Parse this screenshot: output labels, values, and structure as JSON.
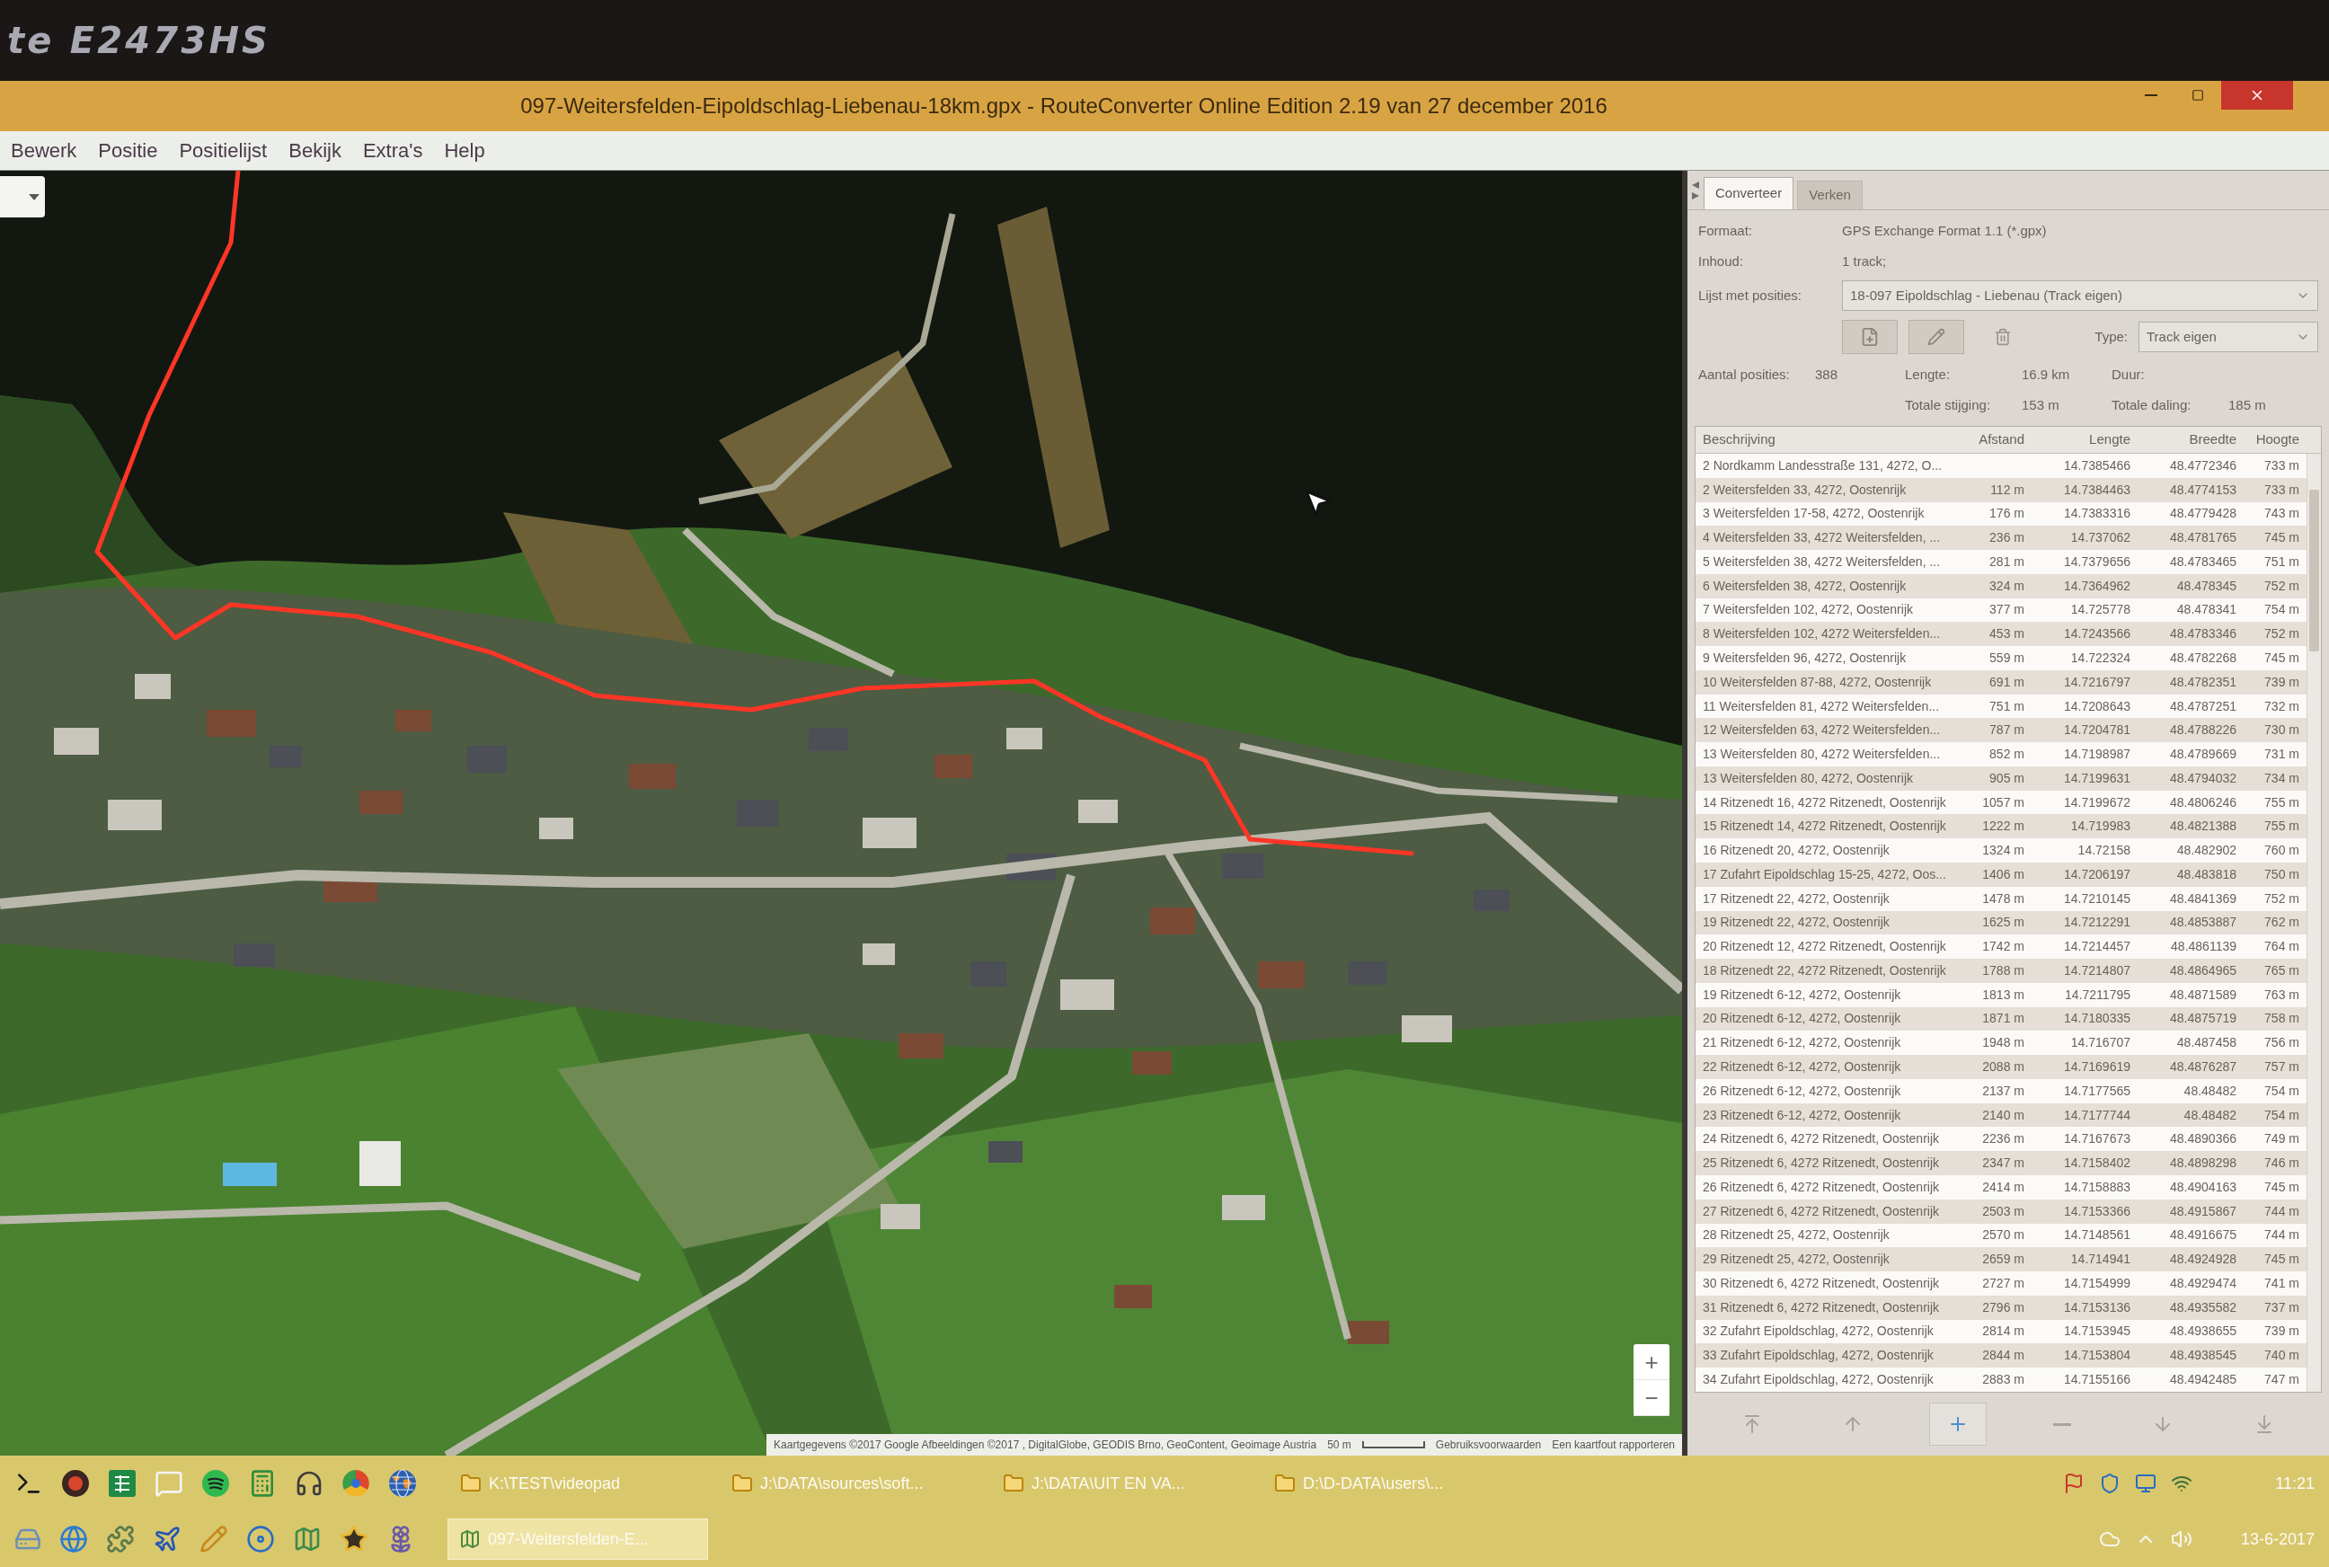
{
  "monitor": {
    "model_label": "te E2473HS"
  },
  "window": {
    "title": "097-Weitersfelden-Eipoldschlag-Liebenau-18km.gpx - RouteConverter Online Edition 2.19 van 27 december 2016"
  },
  "menu": [
    "Bewerk",
    "Positie",
    "Positielijst",
    "Bekijk",
    "Extra's",
    "Help"
  ],
  "map": {
    "zoom_buttons": [
      "+",
      "−"
    ],
    "attribution": "Kaartgegevens ©2017 Google Afbeeldingen ©2017 , DigitalGlobe, GEODIS Brno, GeoContent, Geoimage Austria",
    "scale": "50 m",
    "links": [
      "Gebruiksvoorwaarden",
      "Een kaartfout rapporteren"
    ]
  },
  "panel": {
    "tabs": [
      {
        "label": "Converteer",
        "selected": true
      },
      {
        "label": "Verken",
        "selected": false
      }
    ],
    "info": [
      {
        "label": "Formaat:",
        "value": "GPS Exchange Format 1.1 (*.gpx)"
      },
      {
        "label": "Inhoud:",
        "value": "1 track;"
      }
    ],
    "position_list": {
      "label": "Lijst met posities:",
      "value": "18-097 Eipoldschlag - Liebenau (Track eigen)"
    },
    "type": {
      "label": "Type:",
      "value": "Track eigen"
    },
    "stats": [
      [
        {
          "label": "Aantal posities:",
          "value": "388"
        },
        {
          "label": "Lengte:",
          "value": "16.9 km"
        },
        {
          "label": "Duur:"
        }
      ],
      [
        {
          "label": "Totale stijging:",
          "value": "153 m"
        },
        {
          "label": "Totale daling:",
          "value": "185 m"
        }
      ]
    ],
    "table": {
      "columns": [
        "Beschrijving",
        "Afstand",
        "Lengte",
        "Breedte",
        "Hoogte"
      ],
      "rows": [
        {
          "description": "2 Nordkamm Landesstraße 131, 4272, O...",
          "longitude": "14.7385466",
          "latitude": "48.4772346",
          "elevation": "733 m"
        },
        {
          "description": "2 Weitersfelden 33, 4272, Oostenrijk",
          "distance": "112 m",
          "longitude": "14.7384463",
          "latitude": "48.4774153",
          "elevation": "733 m"
        },
        {
          "description": "3 Weitersfelden 17-58, 4272, Oostenrijk",
          "distance": "176 m",
          "longitude": "14.7383316",
          "latitude": "48.4779428",
          "elevation": "743 m"
        },
        {
          "description": "4 Weitersfelden 33, 4272 Weitersfelden, ...",
          "distance": "236 m",
          "longitude": "14.737062",
          "latitude": "48.4781765",
          "elevation": "745 m"
        },
        {
          "description": "5 Weitersfelden 38, 4272 Weitersfelden, ...",
          "distance": "281 m",
          "longitude": "14.7379656",
          "latitude": "48.4783465",
          "elevation": "751 m"
        },
        {
          "description": "6 Weitersfelden 38, 4272, Oostenrijk",
          "distance": "324 m",
          "longitude": "14.7364962",
          "latitude": "48.478345",
          "elevation": "752 m"
        },
        {
          "description": "7 Weitersfelden 102, 4272, Oostenrijk",
          "distance": "377 m",
          "longitude": "14.725778",
          "latitude": "48.478341",
          "elevation": "754 m"
        },
        {
          "description": "8 Weitersfelden 102, 4272 Weitersfelden...",
          "distance": "453 m",
          "longitude": "14.7243566",
          "latitude": "48.4783346",
          "elevation": "752 m"
        },
        {
          "description": "9 Weitersfelden 96, 4272, Oostenrijk",
          "distance": "559 m",
          "longitude": "14.722324",
          "latitude": "48.4782268",
          "elevation": "745 m"
        },
        {
          "description": "10 Weitersfelden 87-88, 4272, Oostenrijk",
          "distance": "691 m",
          "longitude": "14.7216797",
          "latitude": "48.4782351",
          "elevation": "739 m"
        },
        {
          "description": "11 Weitersfelden 81, 4272 Weitersfelden...",
          "distance": "751 m",
          "longitude": "14.7208643",
          "latitude": "48.4787251",
          "elevation": "732 m"
        },
        {
          "description": "12 Weitersfelden 63, 4272 Weitersfelden...",
          "distance": "787 m",
          "longitude": "14.7204781",
          "latitude": "48.4788226",
          "elevation": "730 m"
        },
        {
          "description": "13 Weitersfelden 80, 4272 Weitersfelden...",
          "distance": "852 m",
          "longitude": "14.7198987",
          "latitude": "48.4789669",
          "elevation": "731 m"
        },
        {
          "description": "13 Weitersfelden 80, 4272, Oostenrijk",
          "distance": "905 m",
          "longitude": "14.7199631",
          "latitude": "48.4794032",
          "elevation": "734 m"
        },
        {
          "description": "14 Ritzenedt 16, 4272 Ritzenedt, Oostenrijk",
          "distance": "1057 m",
          "longitude": "14.7199672",
          "latitude": "48.4806246",
          "elevation": "755 m"
        },
        {
          "description": "15 Ritzenedt 14, 4272 Ritzenedt, Oostenrijk",
          "distance": "1222 m",
          "longitude": "14.719983",
          "latitude": "48.4821388",
          "elevation": "755 m"
        },
        {
          "description": "16 Ritzenedt 20, 4272, Oostenrijk",
          "distance": "1324 m",
          "longitude": "14.72158",
          "latitude": "48.482902",
          "elevation": "760 m"
        },
        {
          "description": "17 Zufahrt Eipoldschlag 15-25, 4272, Oos...",
          "distance": "1406 m",
          "longitude": "14.7206197",
          "latitude": "48.483818",
          "elevation": "750 m"
        },
        {
          "description": "17 Ritzenedt 22, 4272, Oostenrijk",
          "distance": "1478 m",
          "longitude": "14.7210145",
          "latitude": "48.4841369",
          "elevation": "752 m"
        },
        {
          "description": "19 Ritzenedt 22, 4272, Oostenrijk",
          "distance": "1625 m",
          "longitude": "14.7212291",
          "latitude": "48.4853887",
          "elevation": "762 m"
        },
        {
          "description": "20 Ritzenedt 12, 4272 Ritzenedt, Oostenrijk",
          "distance": "1742 m",
          "longitude": "14.7214457",
          "latitude": "48.4861139",
          "elevation": "764 m"
        },
        {
          "description": "18 Ritzenedt 22, 4272 Ritzenedt, Oostenrijk",
          "distance": "1788 m",
          "longitude": "14.7214807",
          "latitude": "48.4864965",
          "elevation": "765 m"
        },
        {
          "description": "19 Ritzenedt 6-12, 4272, Oostenrijk",
          "distance": "1813 m",
          "longitude": "14.7211795",
          "latitude": "48.4871589",
          "elevation": "763 m"
        },
        {
          "description": "20 Ritzenedt 6-12, 4272, Oostenrijk",
          "distance": "1871 m",
          "longitude": "14.7180335",
          "latitude": "48.4875719",
          "elevation": "758 m"
        },
        {
          "description": "21 Ritzenedt 6-12, 4272, Oostenrijk",
          "distance": "1948 m",
          "longitude": "14.716707",
          "latitude": "48.487458",
          "elevation": "756 m"
        },
        {
          "description": "22 Ritzenedt 6-12, 4272, Oostenrijk",
          "distance": "2088 m",
          "longitude": "14.7169619",
          "latitude": "48.4876287",
          "elevation": "757 m"
        },
        {
          "description": "26 Ritzenedt 6-12, 4272, Oostenrijk",
          "distance": "2137 m",
          "longitude": "14.7177565",
          "latitude": "48.48482",
          "elevation": "754 m"
        },
        {
          "description": "23 Ritzenedt 6-12, 4272, Oostenrijk",
          "distance": "2140 m",
          "longitude": "14.7177744",
          "latitude": "48.48482",
          "elevation": "754 m"
        },
        {
          "description": "24 Ritzenedt 6, 4272 Ritzenedt, Oostenrijk",
          "distance": "2236 m",
          "longitude": "14.7167673",
          "latitude": "48.4890366",
          "elevation": "749 m"
        },
        {
          "description": "25 Ritzenedt 6, 4272 Ritzenedt, Oostenrijk",
          "distance": "2347 m",
          "longitude": "14.7158402",
          "latitude": "48.4898298",
          "elevation": "746 m"
        },
        {
          "description": "26 Ritzenedt 6, 4272 Ritzenedt, Oostenrijk",
          "distance": "2414 m",
          "longitude": "14.7158883",
          "latitude": "48.4904163",
          "elevation": "745 m"
        },
        {
          "description": "27 Ritzenedt 6, 4272 Ritzenedt, Oostenrijk",
          "distance": "2503 m",
          "longitude": "14.7153366",
          "latitude": "48.4915867",
          "elevation": "744 m"
        },
        {
          "description": "28 Ritzenedt 25, 4272, Oostenrijk",
          "distance": "2570 m",
          "longitude": "14.7148561",
          "latitude": "48.4916675",
          "elevation": "744 m"
        },
        {
          "description": "29 Ritzenedt 25, 4272, Oostenrijk",
          "distance": "2659 m",
          "longitude": "14.714941",
          "latitude": "48.4924928",
          "elevation": "745 m"
        },
        {
          "description": "30 Ritzenedt 6, 4272 Ritzenedt, Oostenrijk",
          "distance": "2727 m",
          "longitude": "14.7154999",
          "latitude": "48.4929474",
          "elevation": "741 m"
        },
        {
          "description": "31 Ritzenedt 6, 4272 Ritzenedt, Oostenrijk",
          "distance": "2796 m",
          "longitude": "14.7153136",
          "latitude": "48.4935582",
          "elevation": "737 m"
        },
        {
          "description": "32 Zufahrt Eipoldschlag, 4272, Oostenrijk",
          "distance": "2814 m",
          "longitude": "14.7153945",
          "latitude": "48.4938655",
          "elevation": "739 m"
        },
        {
          "description": "33 Zufahrt Eipoldschlag, 4272, Oostenrijk",
          "distance": "2844 m",
          "longitude": "14.7153804",
          "latitude": "48.4938545",
          "elevation": "740 m"
        },
        {
          "description": "34 Zufahrt Eipoldschlag, 4272, Oostenrijk",
          "distance": "2883 m",
          "longitude": "14.7155166",
          "latitude": "48.4942485",
          "elevation": "747 m"
        }
      ]
    }
  },
  "taskbar": {
    "rows": [
      {
        "windows": [
          {
            "label": "K:\\TEST\\videopad",
            "selected": false
          },
          {
            "label": "J:\\DATA\\sources\\soft...",
            "selected": false
          },
          {
            "label": "J:\\DATA\\UIT EN VA...",
            "selected": false
          },
          {
            "label": "D:\\D-DATA\\users\\...",
            "selected": false
          }
        ]
      },
      {
        "windows": [
          {
            "label": "097-Weitersfelden-E...",
            "selected": true
          }
        ]
      }
    ],
    "time": "11:21",
    "date": "13-6-2017"
  }
}
